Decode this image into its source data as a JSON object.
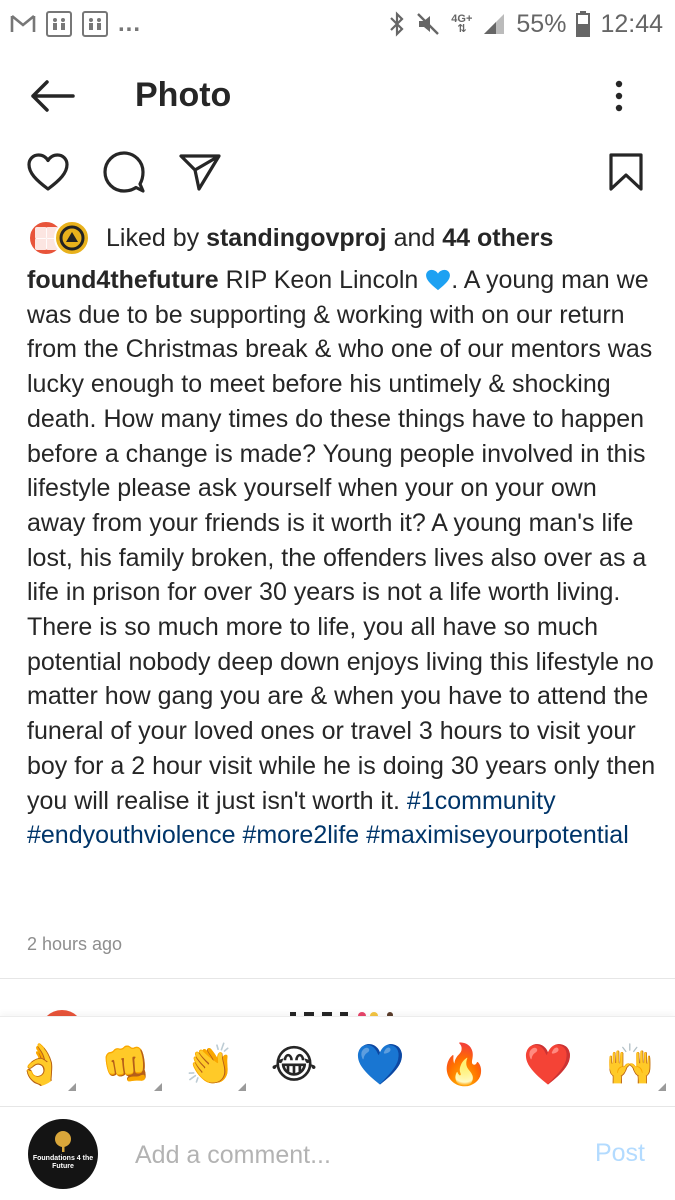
{
  "status_bar": {
    "left_icons": [
      "gmail-icon",
      "app-icon",
      "app-icon"
    ],
    "left_more": "...",
    "network": "4G+",
    "battery": "55%",
    "time": "12:44"
  },
  "header": {
    "title": "Photo"
  },
  "likes": {
    "prefix": "Liked by",
    "user": "standingovproj",
    "middle": "and",
    "others": "44 others"
  },
  "post": {
    "username": "found4thefuture",
    "caption_part1": " RIP Keon Lincoln ",
    "caption_part2": ". A young man we was due to be supporting & working with on our return from the Christmas break & who one of our mentors was lucky enough to meet before his untimely & shocking death. How many times do these things have to happen before a change is made? Young people involved in this lifestyle please ask yourself when your on your own away from your friends is it worth it? A young man's life lost, his family broken, the offenders lives also over as a life in prison for over 30 years is not a life worth living. There is so much more to life, you all have so much potential nobody deep down enjoys living this lifestyle no matter how gang you are & when you have to attend the funeral of your loved ones or travel 3 hours to visit your boy for a 2 hour visit while he is doing 30 years only then you will realise it just isn't worth it. ",
    "hashtags": [
      "#1community",
      "#endyouthviolence",
      "#more2life",
      "#maximiseyourpotential"
    ],
    "timestamp": "2 hours ago"
  },
  "emoji_bar": [
    "👌",
    "👊",
    "👏",
    "😂",
    "💙",
    "🔥",
    "❤️",
    "🙌"
  ],
  "composer": {
    "avatar_text": "Foundations 4 the Future",
    "placeholder": "Add a comment...",
    "post_label": "Post"
  },
  "colors": {
    "text": "#262626",
    "hashtag": "#003569",
    "muted": "#8e8e8e",
    "post_disabled": "#b3dbff"
  }
}
